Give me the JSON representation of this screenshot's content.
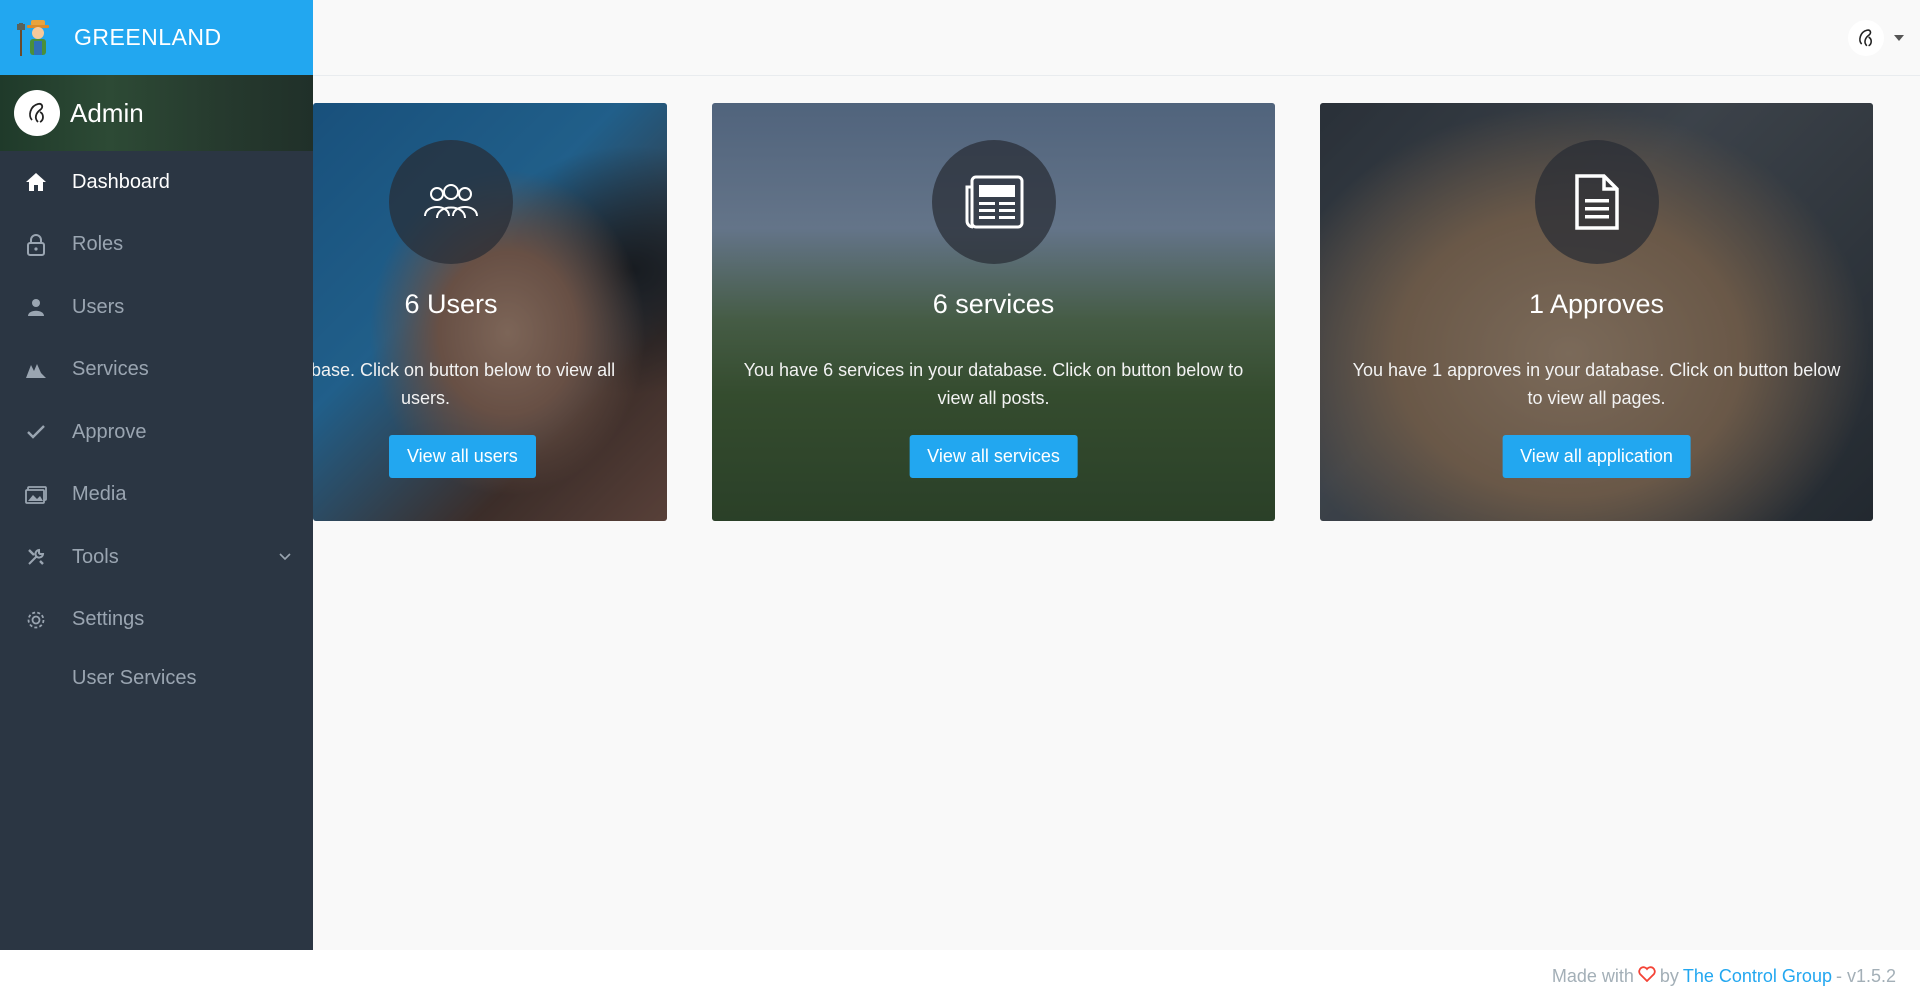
{
  "brand": {
    "name": "GREENLAND",
    "accent": "#22a7f0"
  },
  "admin": {
    "name": "Admin"
  },
  "sidebar": {
    "items": [
      {
        "label": "Dashboard",
        "icon": "home-icon",
        "active": true
      },
      {
        "label": "Roles",
        "icon": "lock-icon"
      },
      {
        "label": "Users",
        "icon": "person-icon"
      },
      {
        "label": "Services",
        "icon": "services-icon"
      },
      {
        "label": "Approve",
        "icon": "check-icon"
      },
      {
        "label": "Media",
        "icon": "media-icon"
      },
      {
        "label": "Tools",
        "icon": "tools-icon",
        "expandable": true
      },
      {
        "label": "Settings",
        "icon": "gear-icon"
      },
      {
        "label": "User Services"
      }
    ]
  },
  "cards": [
    {
      "title": "6 Users",
      "text": "your database. Click on button below to view all users.",
      "button": "View all users",
      "icon": "users-icon"
    },
    {
      "title": "6 services",
      "text": "You have 6 services in your database. Click on button below to view all posts.",
      "button": "View all services",
      "icon": "newspaper-icon"
    },
    {
      "title": "1 Approves",
      "text": "You have 1 approves in your database. Click on button below to view all pages.",
      "button": "View all application",
      "icon": "document-icon"
    }
  ],
  "footer": {
    "made_with": "Made with",
    "by": "by",
    "company": "The Control Group",
    "version": "- v1.5.2"
  }
}
